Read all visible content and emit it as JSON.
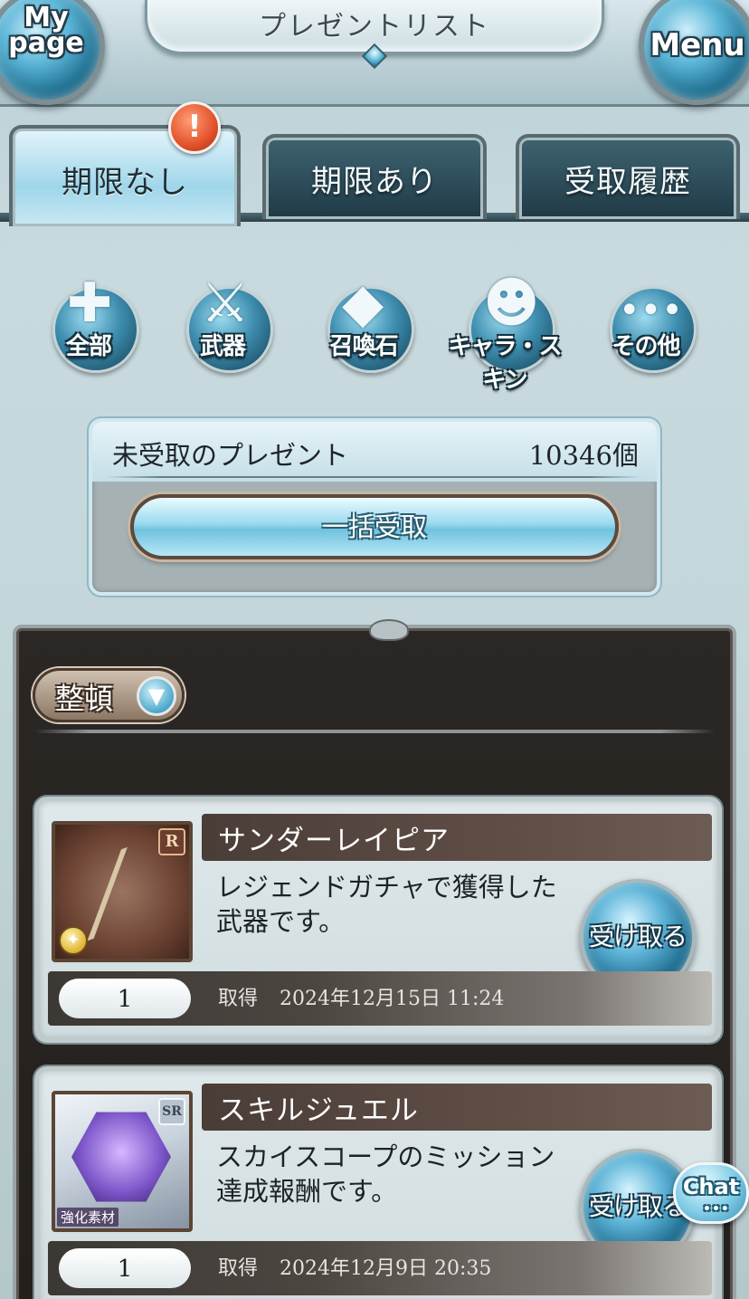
{
  "header": {
    "title": "プレゼントリスト",
    "mypage_line1": "My",
    "mypage_line2": "page",
    "menu_label": "Menu"
  },
  "tabs": [
    {
      "label": "期限なし",
      "active": true,
      "badge": "!"
    },
    {
      "label": "期限あり",
      "active": false
    },
    {
      "label": "受取履歴",
      "active": false
    }
  ],
  "categories": [
    {
      "label": "全部",
      "icon": "all-items-icon"
    },
    {
      "label": "武器",
      "icon": "sword-icon"
    },
    {
      "label": "召喚石",
      "icon": "crystal-icon"
    },
    {
      "label": "キャラ・スキン",
      "icon": "character-icon"
    },
    {
      "label": "その他",
      "icon": "more-dots-icon"
    }
  ],
  "summary": {
    "label": "未受取のプレゼント",
    "count": "10346個",
    "bulk_receive_label": "一括受取"
  },
  "list": {
    "sort_label": "整頓"
  },
  "presents": [
    {
      "name": "サンダーレイピア",
      "description": "レジェンドガチャで獲得した武器です。",
      "rarity": "R",
      "quantity": "1",
      "acquired_label": "取得",
      "acquired_date": "2024年12月15日 11:24",
      "receive_label": "受け取る"
    },
    {
      "name": "スキルジュエル",
      "description": "スカイスコープのミッション達成報酬です。",
      "rarity": "SR",
      "tag": "強化素材",
      "quantity": "1",
      "acquired_label": "取得",
      "acquired_date": "2024年12月9日 20:35",
      "receive_label": "受け取る"
    }
  ],
  "chat": {
    "label": "Chat"
  },
  "colors": {
    "accent_blue": "#5fb5d8",
    "panel_dark": "#2b2724",
    "badge_red": "#e2522a"
  }
}
